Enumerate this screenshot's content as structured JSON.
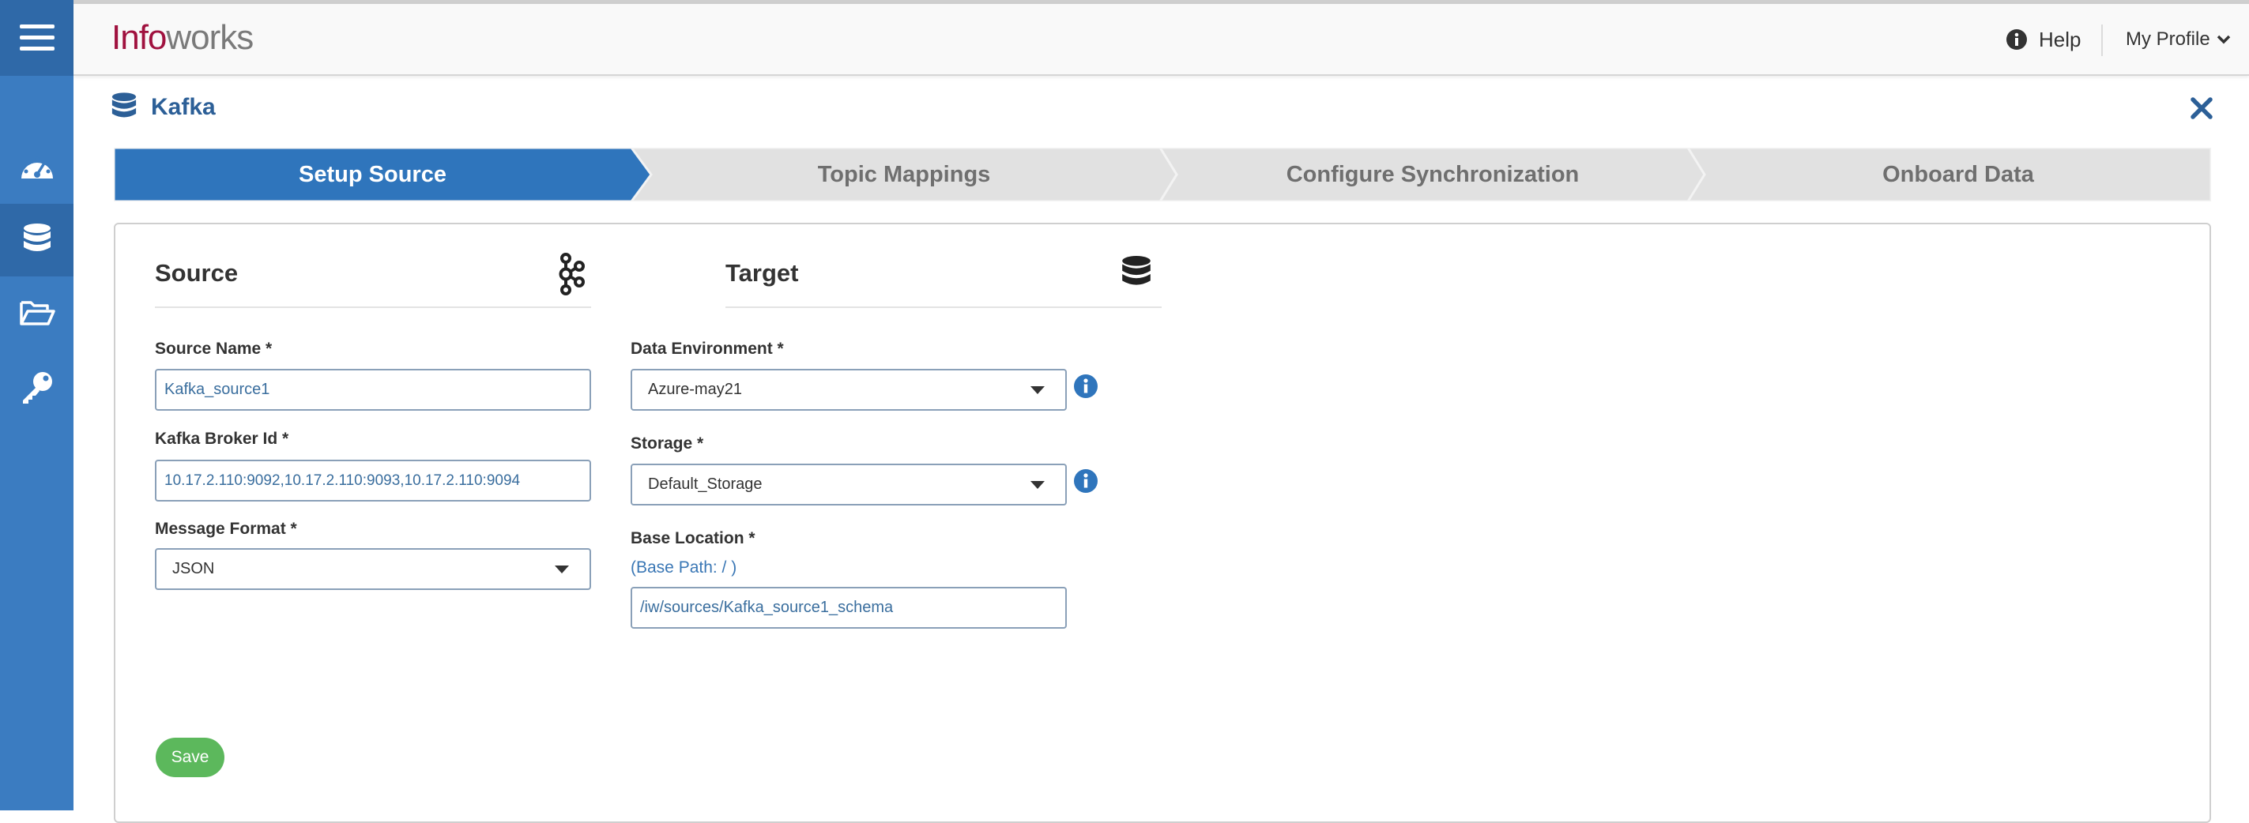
{
  "app": {
    "logo_part1": "Info",
    "logo_part2": "works"
  },
  "header": {
    "help_label": "Help",
    "profile_label": "My Profile"
  },
  "page": {
    "title": "Kafka"
  },
  "steps": [
    {
      "label": "Setup Source",
      "active": true
    },
    {
      "label": "Topic Mappings",
      "active": false
    },
    {
      "label": "Configure Synchronization",
      "active": false
    },
    {
      "label": "Onboard Data",
      "active": false
    }
  ],
  "source": {
    "title": "Source",
    "name_label": "Source Name *",
    "name_value": "Kafka_source1",
    "broker_label": "Kafka Broker Id *",
    "broker_value": "10.17.2.110:9092,10.17.2.110:9093,10.17.2.110:9094",
    "format_label": "Message Format *",
    "format_value": "JSON"
  },
  "target": {
    "title": "Target",
    "env_label": "Data Environment *",
    "env_value": "Azure-may21",
    "storage_label": "Storage *",
    "storage_value": "Default_Storage",
    "location_label": "Base Location *",
    "base_path_hint": "(Base Path: / )",
    "location_value": "/iw/sources/Kafka_source1_schema"
  },
  "actions": {
    "save_label": "Save"
  },
  "colors": {
    "sidebar": "#3b7cc1",
    "active_step": "#2f75bc",
    "inactive_step": "#e1e1e1",
    "save": "#5cb85c",
    "title": "#2c5f97"
  }
}
